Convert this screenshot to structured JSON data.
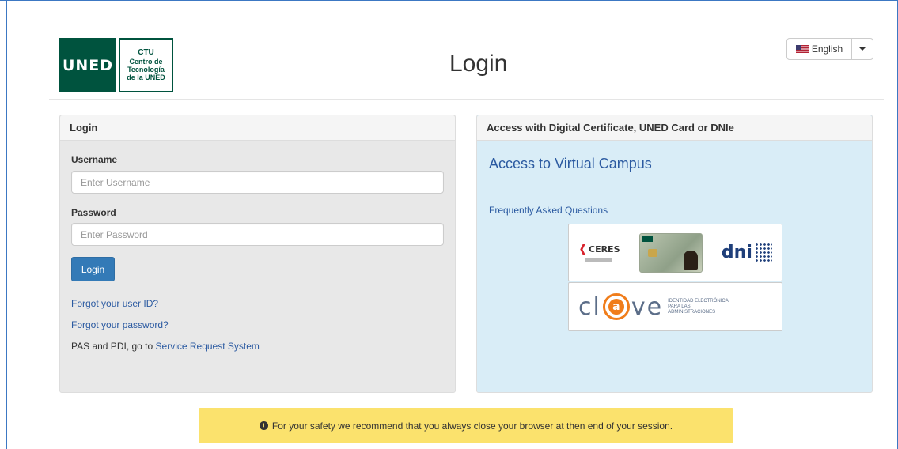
{
  "header": {
    "logo_uned": "UNED",
    "logo_ctu": {
      "line1": "CTU",
      "line2": "Centro de",
      "line3": "Tecnología",
      "line4": "de la UNED"
    },
    "title": "Login",
    "language": {
      "selected": "English",
      "icon": "us-flag-icon"
    }
  },
  "login_panel": {
    "heading": "Login",
    "username_label": "Username",
    "username_placeholder": "Enter Username",
    "username_value": "",
    "password_label": "Password",
    "password_placeholder": "Enter Password",
    "password_value": "",
    "login_button": "Login",
    "forgot_user_id": "Forgot your user ID?",
    "forgot_password": "Forgot your password?",
    "pas_prefix": "PAS and PDI, go to ",
    "service_request_link": "Service Request System"
  },
  "cert_panel": {
    "heading_prefix": "Access with Digital Certificate, ",
    "heading_uned": "UNED",
    "heading_middle": " Card or ",
    "heading_dnie": "DNIe",
    "access_link": "Access to Virtual Campus",
    "faq_link": "Frequently Asked Questions",
    "ceres_label": "CERES",
    "dni_label": "dni",
    "clave_left": "cl",
    "clave_right": "ve",
    "clave_caption": "IDENTIDAD ELECTRÓNICA PARA LAS ADMINISTRACIONES"
  },
  "alert": {
    "icon": "exclamation-circle-icon",
    "text": "For your safety we recommend that you always close your browser at then end of your session."
  },
  "colors": {
    "brand_green": "#00533e",
    "link_blue": "#2b5aa1",
    "button_blue": "#337ab7",
    "info_panel": "#d9edf7",
    "alert_yellow": "#fbe26d"
  }
}
